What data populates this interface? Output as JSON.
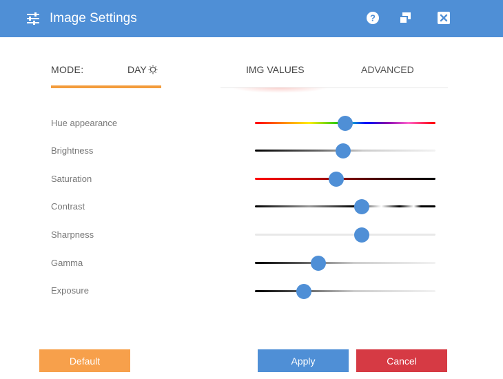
{
  "window": {
    "title": "Image Settings",
    "icons": [
      "settings-sliders-icon",
      "help-icon",
      "restore-icon",
      "close-icon"
    ]
  },
  "mode": {
    "label": "MODE:",
    "value": "DAY",
    "icon": "sun-icon"
  },
  "tabs": [
    {
      "label": "IMG VALUES",
      "active": true
    },
    {
      "label": "ADVANCED",
      "active": false
    }
  ],
  "sliders": [
    {
      "label": "Hue appearance",
      "value_fraction": 0.5
    },
    {
      "label": "Brightness",
      "value_fraction": 0.49
    },
    {
      "label": "Saturation",
      "value_fraction": 0.45
    },
    {
      "label": "Contrast",
      "value_fraction": 0.59
    },
    {
      "label": "Sharpness",
      "value_fraction": 0.59
    },
    {
      "label": "Gamma",
      "value_fraction": 0.35
    },
    {
      "label": "Exposure",
      "value_fraction": 0.27
    }
  ],
  "buttons": {
    "default": "Default",
    "apply": "Apply",
    "cancel": "Cancel"
  },
  "colors": {
    "title_bar": "#4f8fd6",
    "accent_orange": "#f39c3c",
    "apply": "#4f8fd6",
    "cancel": "#d63a44",
    "default": "#f7a04b"
  }
}
